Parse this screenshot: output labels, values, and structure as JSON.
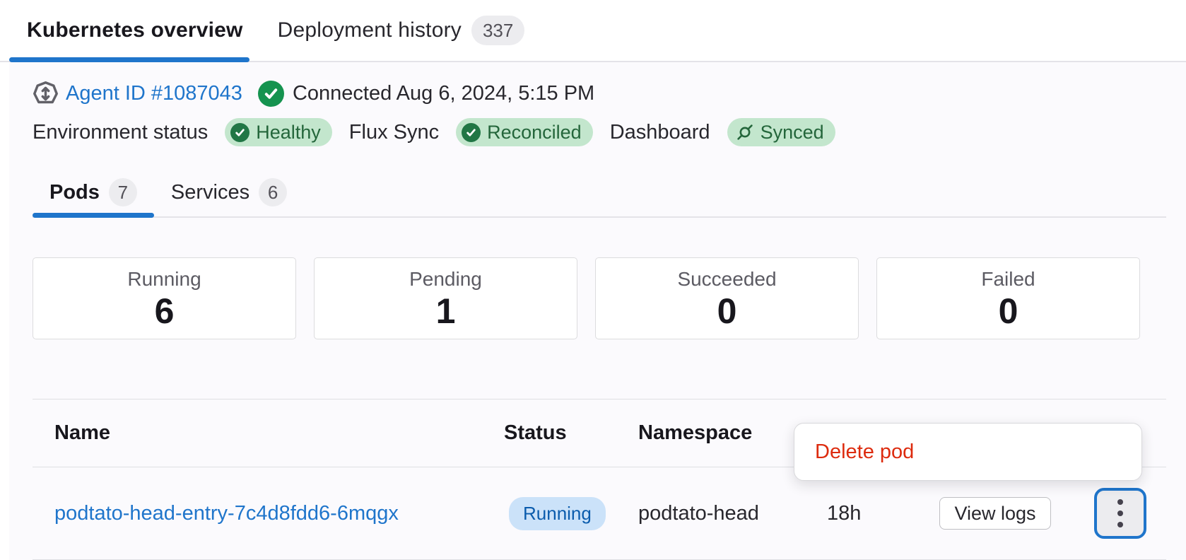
{
  "tabs": {
    "overview_label": "Kubernetes overview",
    "history_label": "Deployment history",
    "history_count": "337"
  },
  "agent": {
    "link_label": "Agent ID #1087043",
    "connected_text": "Connected Aug 6, 2024, 5:15 PM"
  },
  "environment": {
    "status_label": "Environment status",
    "status_badge": "Healthy",
    "flux_label": "Flux Sync",
    "flux_badge": "Reconciled",
    "dashboard_label": "Dashboard",
    "dashboard_badge": "Synced"
  },
  "subtabs": {
    "pods_label": "Pods",
    "pods_count": "7",
    "services_label": "Services",
    "services_count": "6"
  },
  "stats": [
    {
      "label": "Running",
      "value": "6"
    },
    {
      "label": "Pending",
      "value": "1"
    },
    {
      "label": "Succeeded",
      "value": "0"
    },
    {
      "label": "Failed",
      "value": "0"
    }
  ],
  "table": {
    "headers": {
      "name": "Name",
      "status": "Status",
      "namespace": "Namespace"
    },
    "rows": [
      {
        "name": "podtato-head-entry-7c4d8fdd6-6mqgx",
        "status": "Running",
        "namespace": "podtato-head",
        "age": "18h",
        "logs_label": "View logs"
      }
    ]
  },
  "menu": {
    "items": [
      {
        "label": "Delete pod"
      }
    ]
  },
  "icons": {
    "agent": "kubernetes-agent-icon",
    "connected": "check-circle-icon",
    "healthy": "check-circle-icon",
    "reconciled": "check-circle-icon",
    "synced": "connected-link-icon",
    "row_actions": "vertical-ellipsis-icon"
  },
  "colors": {
    "accent_blue": "#1f75cb",
    "link_blue": "#1f75cb",
    "success_badge_bg": "#c3e6cd",
    "success_badge_text": "#24663b",
    "success_icon_green": "#15934f",
    "info_badge_bg": "#cbe2f9",
    "info_badge_text": "#0b5cad",
    "danger_text": "#dd2b0e",
    "neutral_badge_bg": "#ececef",
    "page_bg": "#fbfafd"
  }
}
